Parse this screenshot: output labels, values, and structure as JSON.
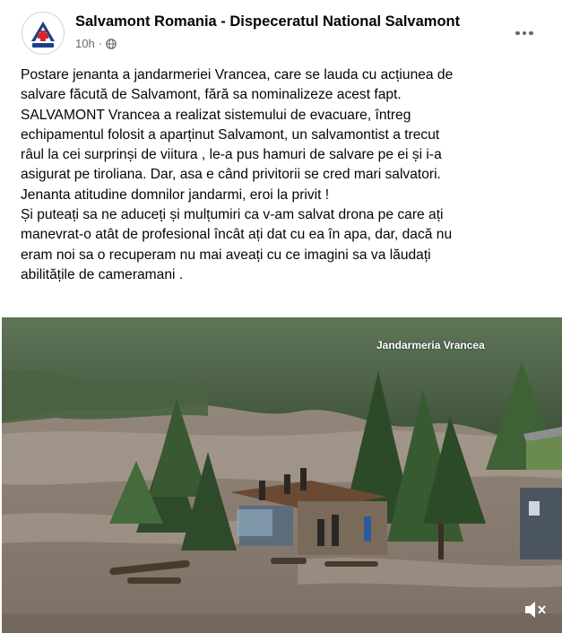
{
  "post": {
    "page_name": "Salvamont Romania - Dispeceratul National Salvamont",
    "time": "10h",
    "time_separator": "·",
    "audience_icon": "globe-icon",
    "more_icon": "more-options-icon",
    "lines": [
      "Postare jenanta a jandarmeriei Vrancea, care se lauda cu acțiunea de",
      "salvare făcută de Salvamont, fără sa nominalizeze acest fapt.",
      "SALVAMONT Vrancea a realizat sistemului de evacuare, întreg",
      "echipamentul folosit a aparținut Salvamont,  un salvamontist a trecut",
      "râul la cei surprinși de viitura , le-a pus hamuri de salvare pe ei și i-a",
      "asigurat pe tiroliana. Dar, asa e când privitorii se cred mari salvatori.",
      "Jenanta atitudine domnilor jandarmi, eroi la privit !",
      "Și puteați sa ne aduceți și mulțumiri ca v-am salvat drona pe care ați",
      "manevrat-o atât de profesional încât ați dat cu ea în apa, dar, dacă nu",
      "eram noi sa o recuperam nu mai aveați cu ce imagini sa va lăudați",
      "abilitățile de cameramani ."
    ]
  },
  "video": {
    "watermark": "Jandarmeria Vrancea",
    "mute_icon": "muted-speaker-icon"
  },
  "colors": {
    "text": "#050505",
    "meta": "#65676b",
    "water": "#8a7d70",
    "forest": "#3e5a36",
    "logo_red": "#d8262e",
    "logo_blue": "#1d3f8a"
  }
}
